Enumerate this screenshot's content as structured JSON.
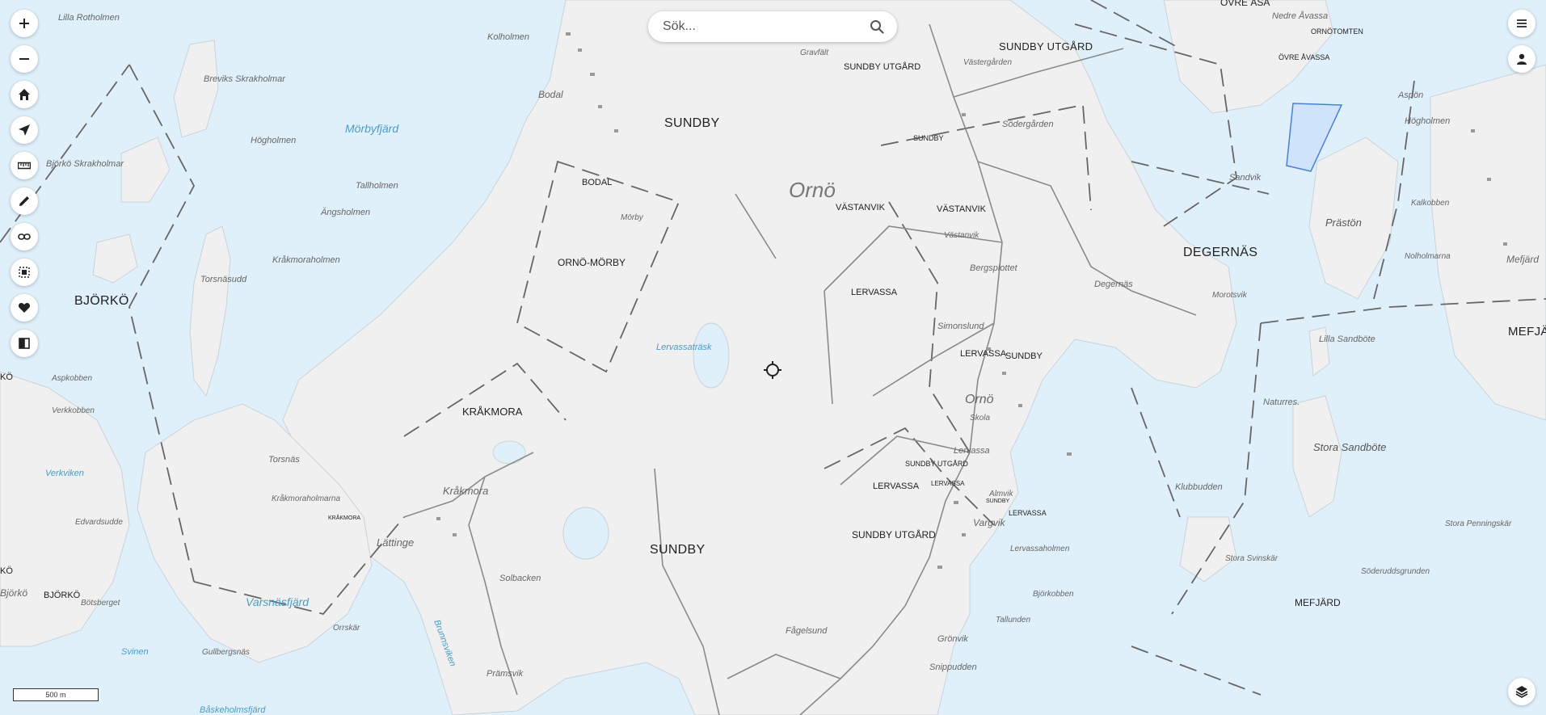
{
  "search": {
    "placeholder": "Sök..."
  },
  "scale": {
    "label": "500 m"
  },
  "toolbar_left": [
    {
      "name": "zoom-in-button",
      "icon": "plus-icon"
    },
    {
      "name": "zoom-out-button",
      "icon": "minus-icon"
    },
    {
      "name": "home-button",
      "icon": "home-icon"
    },
    {
      "name": "locate-button",
      "icon": "navigation-arrow-icon"
    },
    {
      "name": "measure-button",
      "icon": "ruler-icon"
    },
    {
      "name": "draw-button",
      "icon": "pencil-icon"
    },
    {
      "name": "link-button",
      "icon": "link-icon"
    },
    {
      "name": "print-area-button",
      "icon": "dotted-square-icon"
    },
    {
      "name": "favorites-button",
      "icon": "heart-icon"
    },
    {
      "name": "compare-button",
      "icon": "swap-icon"
    }
  ],
  "toolbar_right": [
    {
      "name": "menu-button",
      "icon": "hamburger-icon"
    },
    {
      "name": "account-button",
      "icon": "person-icon"
    }
  ],
  "layers": {
    "icon": "layers-icon"
  },
  "colors": {
    "water": "#dff0fb",
    "land": "#f0f0f0",
    "selection": "#cfe4fb"
  },
  "labels": {
    "lilla_rotholmen": "Lilla Rotholmen",
    "kolholmen": "Kolholmen",
    "bodal_place": "Bodal",
    "sundby_top": "SUNDBY",
    "gravfalt": "Gravfält",
    "sundby_utgard_1": "SUNDBY UTGÅRD",
    "sundby_utgard_2": "SUNDBY UTGÅRD",
    "ovre_asa": "ÖVRE ÅSA",
    "nedre_avassa": "Nedre Åvassa",
    "ornotomten": "ORNÖTOMTEN",
    "ovre_avassa": "ÖVRE ÅVASSA",
    "breviks": "Breviks Skrakholmar",
    "morbyfjard": "Mörbyfjärd",
    "hogholmen": "Högholmen",
    "bjorko_skrakholmar": "Björkö Skrakholmar",
    "tallholmen": "Tallholmen",
    "angsholmen": "Ängsholmen",
    "bodal": "BODAL",
    "morby": "Mörby",
    "orno": "Ornö",
    "vastanvik_1": "VÄSTANVIK",
    "vastanvik_2": "VÄSTANVIK",
    "vastanvik_place": "Västanvik",
    "sundby_small": "SUNDBY",
    "vastergarden": "Västergården",
    "sodergarden": "Södergården",
    "aspon": "Aspön",
    "hogholmen_e": "Högholmen",
    "sandvik": "Sandvik",
    "prastön": "Prästön",
    "kalkobben": "Kalkobben",
    "degernas": "DEGERNÄS",
    "degernas_place": "Degernäs",
    "orno_morby": "ORNÖ-MÖRBY",
    "torsnasudd": "Torsnäsudd",
    "krakmoraholmen": "Kråkmoraholmen",
    "bjorko": "BJÖRKÖ",
    "lervassa_1": "LERVASSA",
    "bergsplottet": "Bergsplottet",
    "morotsvik": "Morotsvik",
    "nolholmarna": "Nolholmarna",
    "mefjard_e": "Mefjärd",
    "mefjard_edge": "MEFJÄRD",
    "lilla_sandbote": "Lilla Sandböte",
    "simonslund": "Simonslund",
    "lervassa_2": "LERVASSA",
    "sundby_mid": "SUNDBY",
    "lervassatrask": "Lervassaträsk",
    "aspkobben": "Aspkobben",
    "ko_edge": "KÖ",
    "verkkobben": "Verkkobben",
    "krakmora": "KRÅKMORA",
    "orno_mid": "Ornö",
    "skola": "Skola",
    "naturres": "Naturres.",
    "stora_sandbote": "Stora Sandböte",
    "lervassa_place": "Lervassa",
    "sundby_utgard_3": "SUNDBY UTGÅRD",
    "lervassa_3": "LERVASSA",
    "lervassa_4": "LERVASSA",
    "torsnas": "Torsnäs",
    "verkviken": "Verkviken",
    "krakmora_place": "Kråkmora",
    "krakmoraholmarna": "Kråkmoraholmarna",
    "krakmora_small": "KRÅKMORA",
    "almvik": "Almvik",
    "sundby_tiny": "SUNDBY",
    "lervassa_5": "LERVASSA",
    "klubbudden": "Klubbudden",
    "vargvik": "Vargvik",
    "stora_penningskar": "Stora Penningskär",
    "edvardsudde": "Edvardsudde",
    "sundby_utgard_4": "SUNDBY UTGÅRD",
    "lattinge": "Lättinge",
    "sundby_bottom": "SUNDBY",
    "lervassaholmen": "Lervassaholmen",
    "stora_svinskar": "Stora Svinskär",
    "solbacken": "Solbacken",
    "soderuddsgrunden": "Söderuddsgrunden",
    "ko_edge2": "KÖ",
    "bjorko_place": "Björkö",
    "bjorko_2": "BJÖRKÖ",
    "botsberget": "Bötsberget",
    "bjorkobben": "Björkobben",
    "mefjard_s": "MEFJÄRD",
    "varsnasfjard": "Varsnäsfjärd",
    "tallunden": "Tallunden",
    "orrskar": "Orrskär",
    "brunnsviken": "Brunnsviken",
    "fagelsund": "Fågelsund",
    "gronvik": "Grönvik",
    "svinen": "Svinen",
    "gullbergsnas": "Gullbergsnäs",
    "snippudden": "Snippudden",
    "pramsvik": "Prämsvik",
    "baskeholmsfjard": "Båskeholmsfjärd"
  }
}
